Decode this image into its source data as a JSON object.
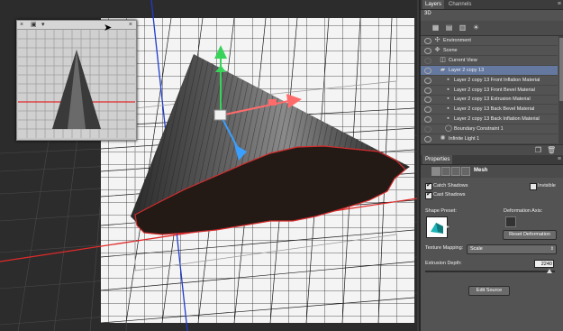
{
  "layers_panel": {
    "tabs": [
      "Layers",
      "Channels"
    ],
    "active_tab": 0,
    "section_label": "3D",
    "toolbar_icons": [
      "scene-filter-icon",
      "mesh-filter-icon",
      "material-filter-icon",
      "light-filter-icon"
    ],
    "items": [
      {
        "label": "Environment",
        "icon": "environment-icon",
        "indent": 0,
        "selected": false,
        "eye": true
      },
      {
        "label": "Scene",
        "icon": "scene-icon",
        "indent": 0,
        "selected": false,
        "eye": true
      },
      {
        "label": "Current View",
        "icon": "camera-icon",
        "indent": 1,
        "selected": false,
        "eye": false
      },
      {
        "label": "Layer 2 copy 13",
        "icon": "mesh-icon",
        "indent": 1,
        "selected": true,
        "eye": true
      },
      {
        "label": "Layer 2 copy 13 Front Inflation Material",
        "icon": "material-icon",
        "indent": 2,
        "selected": false,
        "eye": true
      },
      {
        "label": "Layer 2 copy 13 Front Bevel Material",
        "icon": "material-icon",
        "indent": 2,
        "selected": false,
        "eye": true
      },
      {
        "label": "Layer 2 copy 13 Extrusion Material",
        "icon": "material-icon",
        "indent": 2,
        "selected": false,
        "eye": true
      },
      {
        "label": "Layer 2 copy 13 Back Bevel Material",
        "icon": "material-icon",
        "indent": 2,
        "selected": false,
        "eye": true
      },
      {
        "label": "Layer 2 copy 13 Back Inflation Material",
        "icon": "material-icon",
        "indent": 2,
        "selected": false,
        "eye": true
      },
      {
        "label": "Boundary Constraint 1",
        "icon": "constraint-icon",
        "indent": 2,
        "selected": false,
        "eye": false
      },
      {
        "label": "Infinite Light 1",
        "icon": "light-icon",
        "indent": 1,
        "selected": false,
        "eye": true
      }
    ]
  },
  "properties": {
    "tab": "Properties",
    "section": "Mesh",
    "catch_shadows": {
      "label": "Catch Shadows",
      "checked": true
    },
    "invisible": {
      "label": "Invisible",
      "checked": false
    },
    "cast_shadows": {
      "label": "Cast Shadows",
      "checked": true
    },
    "shape_preset_label": "Shape Preset:",
    "deformation_axis_label": "Deformation Axis:",
    "reset_deformation": "Reset Deformation",
    "texture_mapping_label": "Texture Mapping:",
    "texture_mapping_value": "Scale",
    "extrusion_depth_label": "Extrusion Depth:",
    "extrusion_depth_value": "2240",
    "extrusion_depth_fraction": 0.96,
    "edit_source": "Edit Source"
  },
  "colors": {
    "panel_bg": "#535353",
    "selected_row": "#6478a0",
    "mesh_outline": "#d62c2c",
    "axis_red": "#e02a2a",
    "axis_blue": "#1e3ccc",
    "gizmo_green": "#39d25a",
    "gizmo_red": "#ff6b6b",
    "gizmo_blue": "#3aa0ff"
  }
}
